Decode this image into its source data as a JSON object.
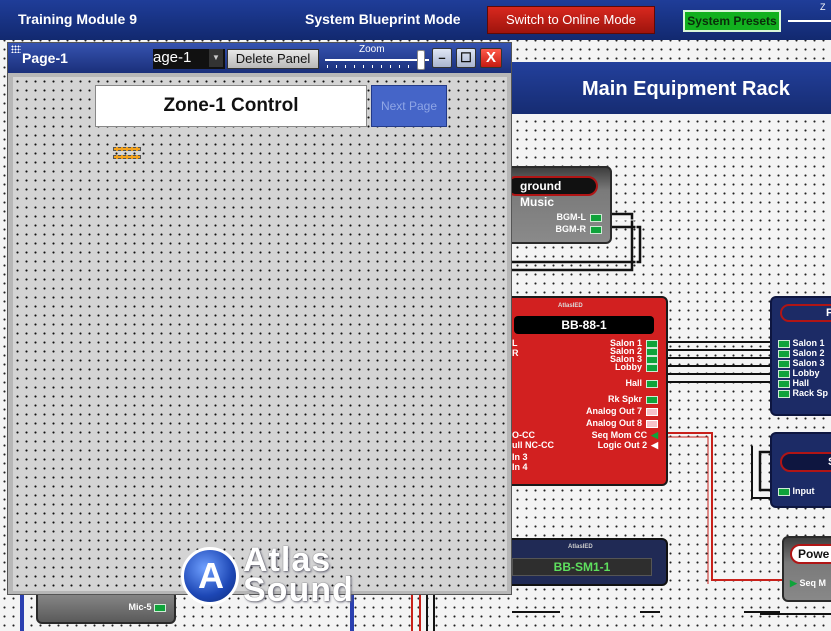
{
  "appbar": {
    "title": "Training Module 9",
    "mode": "System Blueprint Mode",
    "online_button": "Switch to Online Mode",
    "presets_button": "System Presets",
    "mini_slider_label": "Z"
  },
  "panel": {
    "title": "Page-1",
    "page_select_value": "age-1",
    "delete_button": "Delete Panel",
    "zoom_label": "Zoom",
    "zone_title": "Zone-1 Control",
    "next_page": "Next Page",
    "logo_top": "Atlas",
    "logo_bottom": "Sound"
  },
  "canvas": {
    "rack_title": "Main Equipment Rack",
    "bgm": {
      "name": "ground Music",
      "outputs": [
        "BGM-L",
        "BGM-R"
      ]
    },
    "bb88": {
      "brand": "AtlasIED",
      "name": "BB-88-1",
      "outputs": [
        "Salon 1",
        "Salon 2",
        "Salon 3",
        "Lobby",
        "Hall",
        "Rk Spkr",
        "Analog Out 7",
        "Analog Out 8",
        "Seq Mom CC",
        "Logic Out 2"
      ],
      "inputs": [
        "L",
        "R",
        "O-CC",
        "ull NC-CC",
        "In 3",
        "In 4"
      ]
    },
    "zones": {
      "name": "F",
      "inputs": [
        "Salon 1",
        "Salon 2",
        "Salon 3",
        "Lobby",
        "Hall",
        "Rack Sp"
      ]
    },
    "sdev": {
      "name": "S",
      "input": "Input"
    },
    "power": {
      "name": "Powe",
      "input": "Seq M"
    },
    "sm1": {
      "brand": "AtlasIED",
      "name": "BB-SM1-1"
    },
    "mic5": {
      "label": "Mic-5"
    }
  },
  "colors": {
    "appbar": "#1a348a",
    "online_button": "#c41e16",
    "presets": "#12b01f",
    "device_red": "#d22020",
    "wire_red": "#c8201a",
    "wire_blue": "#2a3fb0"
  }
}
